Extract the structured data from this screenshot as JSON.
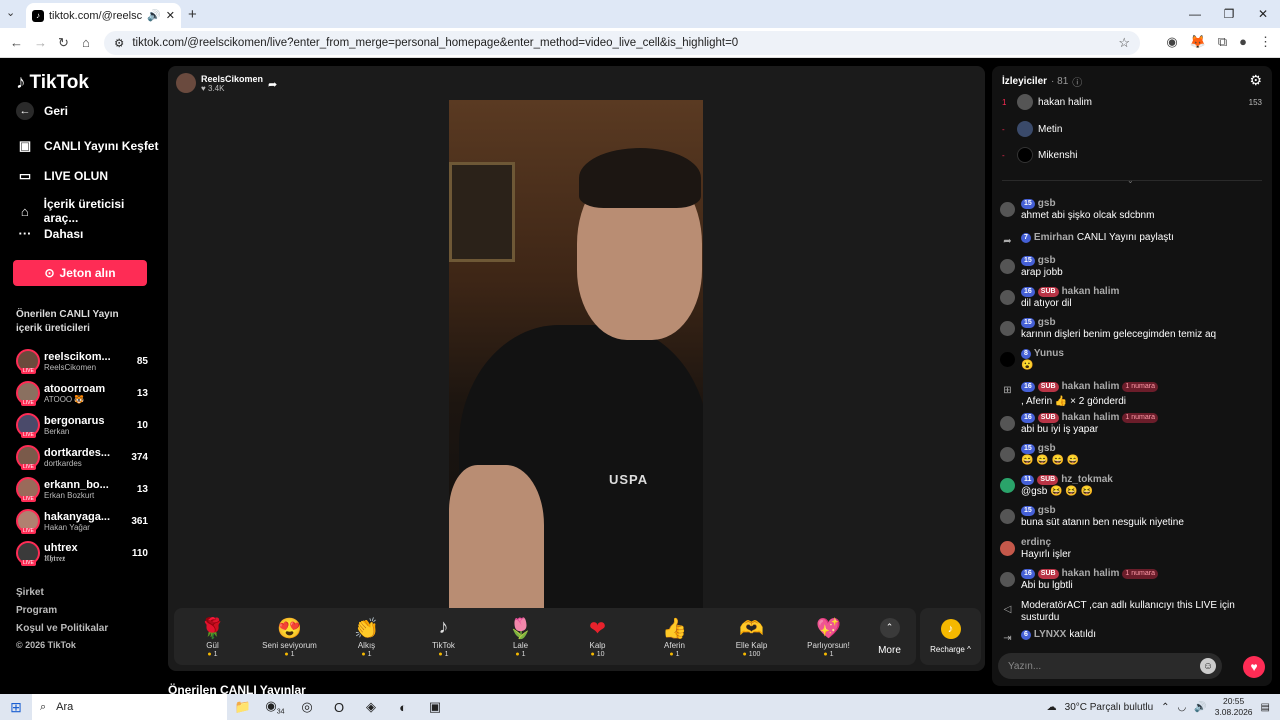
{
  "browser": {
    "tab_title": "tiktok.com/@reelscikomen",
    "url": "tiktok.com/@reelscikomen/live?enter_from_merge=personal_homepage&enter_method=video_live_cell&is_highlight=0"
  },
  "sidebar": {
    "logo": "TikTok",
    "back": "Geri",
    "nav": [
      "CANLI Yayını Keşfet",
      "LIVE OLUN",
      "İçerik üreticisi araç...",
      "Dahası"
    ],
    "coin_button": "Jeton alın",
    "suggested_title": "Önerilen CANLI Yayın içerik üreticileri",
    "creators": [
      {
        "name": "reelscikom...",
        "sub": "ReelsCikomen",
        "count": "85"
      },
      {
        "name": "atooorroam",
        "sub": "ATOOO 🐯",
        "count": "13"
      },
      {
        "name": "bergonarus",
        "sub": "Berkan",
        "count": "10"
      },
      {
        "name": "dortkardes...",
        "sub": "dortkardes",
        "count": "374"
      },
      {
        "name": "erkann_bo...",
        "sub": "Erkan Bozkurt",
        "count": "13"
      },
      {
        "name": "hakanyaga...",
        "sub": "Hakan Yağar",
        "count": "361"
      },
      {
        "name": "uhtrex",
        "sub": "𝖀𝖍𝖙𝖗𝖊𝖝",
        "count": "110"
      }
    ],
    "footer": [
      "Şirket",
      "Program",
      "Koşul ve Politikalar",
      "© 2026 TikTok"
    ]
  },
  "stream": {
    "host_name": "ReelsCikomen",
    "likes": "♥ 3.4K",
    "shirt_text": "USPA"
  },
  "gifts": [
    {
      "icon": "🌹",
      "name": "Gül",
      "price": "1"
    },
    {
      "icon": "😍",
      "name": "Seni seviyorum",
      "price": "1"
    },
    {
      "icon": "👏",
      "name": "Alkış",
      "price": "1"
    },
    {
      "icon": "♪",
      "name": "TikTok",
      "price": "1"
    },
    {
      "icon": "🌷",
      "name": "Lale",
      "price": "1"
    },
    {
      "icon": "❤",
      "name": "Kalp",
      "price": "10"
    },
    {
      "icon": "👍",
      "name": "Aferin",
      "price": "1"
    },
    {
      "icon": "🫶",
      "name": "Elle Kalp",
      "price": "100"
    },
    {
      "icon": "💖",
      "name": "Parlıyorsun!",
      "price": "1"
    }
  ],
  "more_label": "More",
  "recharge_label": "Recharge ^",
  "below_title": "Önerilen CANLI Yayınlar",
  "chat": {
    "viewers_label": "İzleyiciler",
    "viewers_count": "· 81",
    "viewers": [
      {
        "rank": "1",
        "name": "hakan halim",
        "score": "153"
      },
      {
        "rank": "-",
        "name": "Metin",
        "score": ""
      },
      {
        "rank": "-",
        "name": "Mikenshi",
        "score": ""
      }
    ],
    "messages": [
      {
        "badge": "15",
        "sub": "",
        "rank": "",
        "user": "gsb",
        "text": "ahmet abi şişko olcak sdcbnm"
      },
      {
        "badge": "7",
        "sub": "",
        "rank": "",
        "user": "Emirhan",
        "text": "CANLI Yayını paylaştı"
      },
      {
        "badge": "15",
        "sub": "",
        "rank": "",
        "user": "gsb",
        "text": "arap jobb"
      },
      {
        "badge": "16",
        "sub": "SUB",
        "rank": "",
        "user": "hakan halim",
        "text": "dil atıyor dil"
      },
      {
        "badge": "15",
        "sub": "",
        "rank": "",
        "user": "gsb",
        "text": "karının dişleri benim gelecegimden temiz aq"
      },
      {
        "badge": "8",
        "sub": "",
        "rank": "",
        "user": "Yunus",
        "text": "😮"
      },
      {
        "badge": "16",
        "sub": "SUB",
        "rank": "1 numara",
        "user": "hakan halim",
        "text": ", Aferin 👍 × 2 gönderdi"
      },
      {
        "badge": "16",
        "sub": "SUB",
        "rank": "1 numara",
        "user": "hakan halim",
        "text": "abi bu iyi iş yapar"
      },
      {
        "badge": "15",
        "sub": "",
        "rank": "",
        "user": "gsb",
        "text": "😄 😄 😄 😄"
      },
      {
        "badge": "11",
        "sub": "SUB",
        "rank": "",
        "user": "hz_tokmak",
        "text": "@gsb 😆 😆 😆"
      },
      {
        "badge": "15",
        "sub": "",
        "rank": "",
        "user": "gsb",
        "text": "buna süt atanın ben nesguik niyetine"
      },
      {
        "badge": "",
        "sub": "",
        "rank": "",
        "user": "erdinç",
        "text": "Hayırlı işler"
      },
      {
        "badge": "16",
        "sub": "SUB",
        "rank": "1 numara",
        "user": "hakan halim",
        "text": "Abi bu lgbtli"
      },
      {
        "badge": "",
        "sub": "",
        "rank": "",
        "user": "ModeratörACT ,can",
        "text": "adlı kullanıcıyı this LIVE için susturdu"
      },
      {
        "badge": "6",
        "sub": "",
        "rank": "",
        "user": "LYNXX",
        "text": "katıldı"
      }
    ],
    "compose_placeholder": "Yazın..."
  },
  "taskbar": {
    "search": "Ara",
    "badge": "34",
    "weather": "30°C  Parçalı bulutlu",
    "time": "20:55",
    "date": "3.08.2026"
  }
}
